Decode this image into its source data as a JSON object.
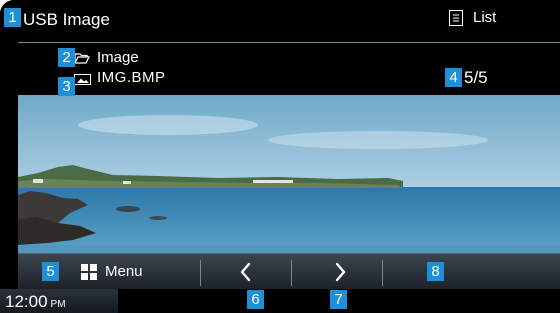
{
  "header": {
    "title": "USB Image"
  },
  "info": {
    "folder_name": "Image",
    "file_name": "IMG.BMP",
    "counter": "5/5"
  },
  "toolbar": {
    "menu_label": "Menu",
    "prev_glyph": "<",
    "next_glyph": ">",
    "list_label": "List"
  },
  "status": {
    "time": "12:00",
    "ampm": "PM"
  },
  "callouts": [
    "1",
    "2",
    "3",
    "4",
    "5",
    "6",
    "7",
    "8"
  ],
  "icons": [
    "folder-icon",
    "image-file-icon",
    "grid-menu-icon",
    "list-icon",
    "chevron-left-icon",
    "chevron-right-icon"
  ],
  "colors": {
    "callout": "#1f8fd8",
    "bar": "#2a323a",
    "background": "#000000"
  }
}
